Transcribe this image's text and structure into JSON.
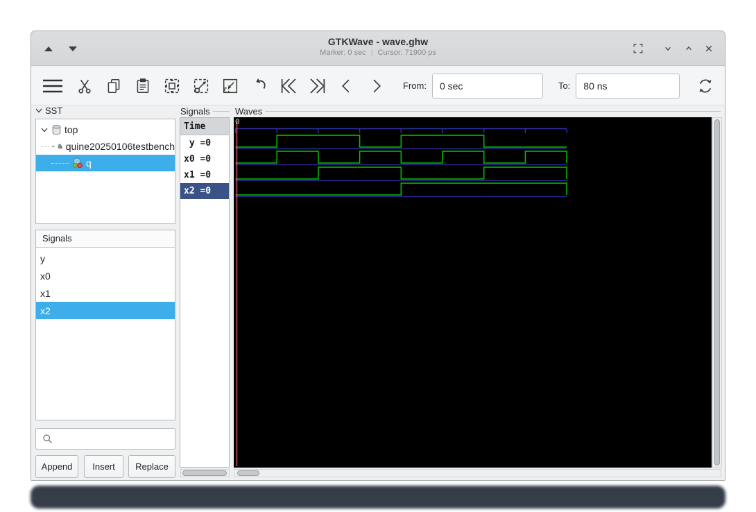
{
  "window": {
    "title": "GTKWave - wave.ghw",
    "marker_text": "Marker: 0 sec",
    "subtitle_separator": "|",
    "cursor_text": "Cursor: 71900 ps"
  },
  "toolbar": {
    "from_label": "From:",
    "from_value": "0 sec",
    "to_label": "To:",
    "to_value": "80 ns"
  },
  "sst": {
    "header": "SST",
    "tree": [
      {
        "label": "top",
        "icon": "cylinder-icon",
        "selected": false
      },
      {
        "label": "quine20250106testbench",
        "icon": "spheres-icon",
        "selected": false
      },
      {
        "label": "q",
        "icon": "spheres-icon",
        "selected": true
      }
    ],
    "signals_header": "Signals",
    "signal_list": [
      {
        "label": "y",
        "selected": false
      },
      {
        "label": "x0",
        "selected": false
      },
      {
        "label": "x1",
        "selected": false
      },
      {
        "label": "x2",
        "selected": true
      }
    ],
    "buttons": [
      "Append",
      "Insert",
      "Replace"
    ]
  },
  "values_panel": {
    "frame_label": "Signals",
    "time_header": "Time",
    "rows": [
      {
        "text": " y =0",
        "selected": false
      },
      {
        "text": "x0 =0",
        "selected": false
      },
      {
        "text": "x1 =0",
        "selected": false
      },
      {
        "text": "x2 =0",
        "selected": true
      }
    ]
  },
  "waves": {
    "frame_label": "Waves",
    "origin_label": "0",
    "chart_data": {
      "type": "line",
      "x_unit": "ns",
      "t_start": 0,
      "t_end": 80,
      "interval_ns": 10,
      "ticks_ns": [
        0,
        10,
        20,
        30,
        40,
        50,
        60,
        70,
        80
      ],
      "marker_ns": 0,
      "series": [
        {
          "name": "y",
          "values": [
            0,
            1,
            1,
            0,
            1,
            1,
            0,
            0
          ]
        },
        {
          "name": "x0",
          "values": [
            0,
            1,
            0,
            1,
            0,
            1,
            0,
            1
          ]
        },
        {
          "name": "x1",
          "values": [
            0,
            0,
            1,
            1,
            0,
            0,
            1,
            1
          ]
        },
        {
          "name": "x2",
          "values": [
            0,
            0,
            0,
            0,
            1,
            1,
            1,
            1
          ]
        }
      ]
    }
  },
  "colors": {
    "accent_blue": "#3daee9",
    "value_selection_navy": "#3a5286",
    "wave_green": "#00c800",
    "wave_grid": "#3131a8",
    "wave_marker": "#e05c5c",
    "wave_bg": "#000000"
  }
}
